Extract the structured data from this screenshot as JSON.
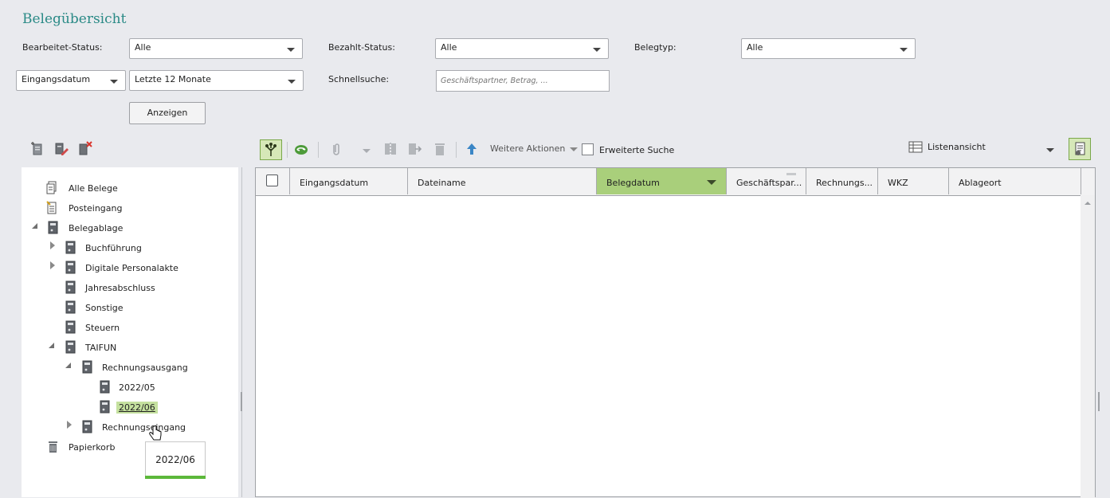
{
  "page": {
    "title": "Belegübersicht"
  },
  "filters": {
    "bearbeitet_label": "Bearbeitet-Status:",
    "bearbeitet_value": "Alle",
    "bezahlt_label": "Bezahlt-Status:",
    "bezahlt_value": "Alle",
    "belegtyp_label": "Belegtyp:",
    "belegtyp_value": "Alle",
    "date_field_value": "Eingangsdatum",
    "period_value": "Letzte 12 Monate",
    "schnellsuche_label": "Schnellsuche:",
    "schnellsuche_placeholder": "Geschäftspartner, Betrag, ...",
    "show_button": "Anzeigen"
  },
  "toolbar": {
    "more_actions": "Weitere Aktionen",
    "extended_search": "Erweiterte Suche",
    "extended_search_checked": false,
    "view_mode": "Listenansicht"
  },
  "tree": {
    "items": [
      {
        "label": "Alle Belege",
        "icon": "documents-icon"
      },
      {
        "label": "Posteingang",
        "icon": "inbox-icon"
      },
      {
        "label": "Belegablage",
        "icon": "binder-icon"
      },
      {
        "label": "Buchführung",
        "icon": "binder-icon"
      },
      {
        "label": "Digitale Personalakte",
        "icon": "binder-icon"
      },
      {
        "label": "Jahresabschluss",
        "icon": "binder-icon"
      },
      {
        "label": "Sonstige",
        "icon": "binder-icon"
      },
      {
        "label": "Steuern",
        "icon": "binder-icon"
      },
      {
        "label": "TAIFUN",
        "icon": "binder-icon"
      },
      {
        "label": "Rechnungsausgang",
        "icon": "binder-icon"
      },
      {
        "label": "2022/05",
        "icon": "binder-icon"
      },
      {
        "label": "2022/06",
        "icon": "binder-icon",
        "selected": true
      },
      {
        "label": "Rechnungseingang",
        "icon": "binder-icon"
      },
      {
        "label": "Papierkorb",
        "icon": "trash-icon"
      }
    ],
    "tooltip": "2022/06"
  },
  "grid": {
    "columns": [
      "Eingangsdatum",
      "Dateiname",
      "Belegdatum",
      "Geschäftspar...",
      "Rechnungs...",
      "WKZ",
      "Ablageort"
    ],
    "sorted_column": "Belegdatum",
    "rows": []
  },
  "colors": {
    "accent_green": "#a9cf7b",
    "title_teal": "#2a8a86",
    "tooltip_bar": "#5cb83a"
  }
}
